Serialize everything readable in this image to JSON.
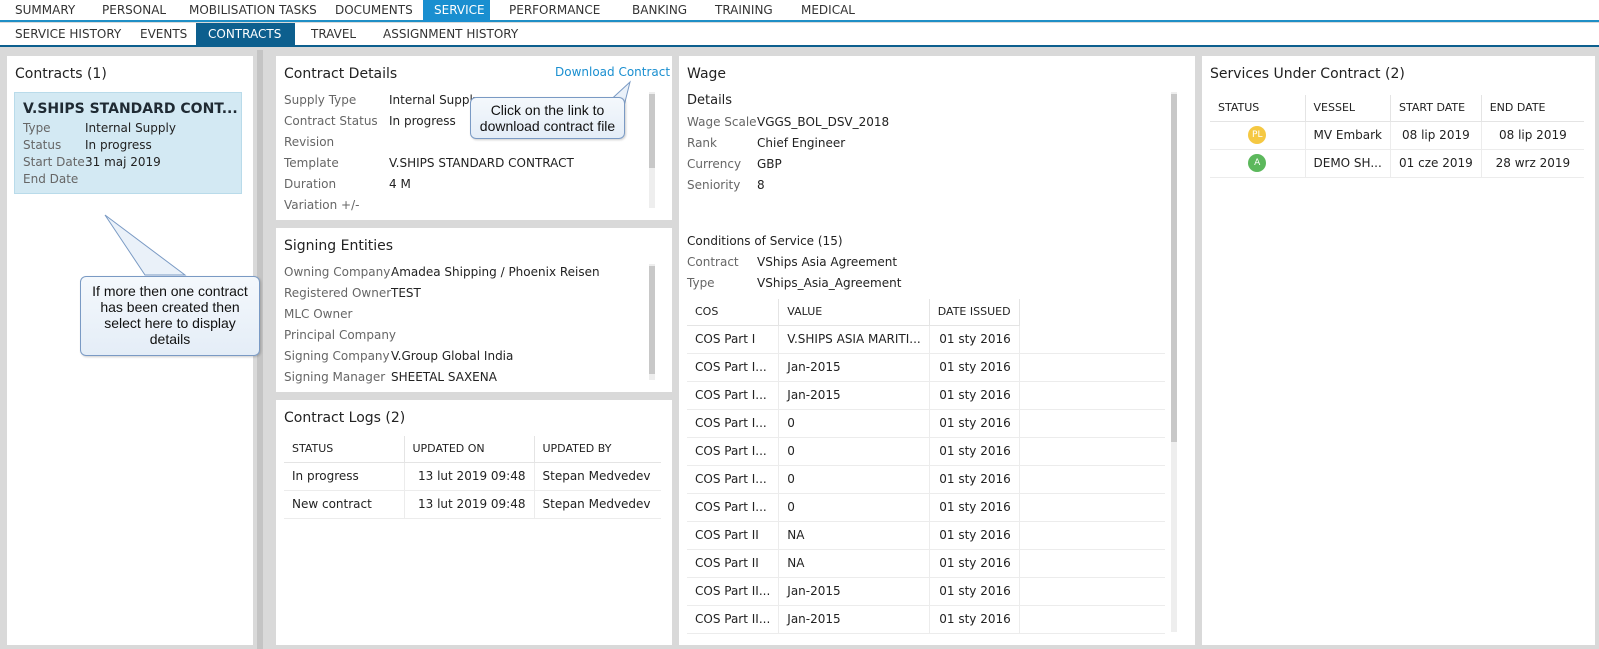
{
  "main_tabs": [
    "SUMMARY",
    "PERSONAL",
    "MOBILISATION TASKS",
    "DOCUMENTS",
    "SERVICE",
    "PERFORMANCE",
    "BANKING",
    "TRAINING",
    "MEDICAL"
  ],
  "sub_tabs": [
    "SERVICE HISTORY",
    "EVENTS",
    "CONTRACTS",
    "TRAVEL",
    "ASSIGNMENT HISTORY"
  ],
  "contracts": {
    "title": "Contracts (1)",
    "card": {
      "name": "V.SHIPS STANDARD CONT...",
      "fields": [
        {
          "label": "Type",
          "value": "Internal Supply"
        },
        {
          "label": "Status",
          "value": "In progress"
        },
        {
          "label": "Start Date",
          "value": "31 maj 2019"
        },
        {
          "label": "End Date",
          "value": ""
        }
      ]
    },
    "callout": "If more then one contract has been created then select here to display details"
  },
  "contract_details": {
    "title": "Contract Details",
    "download_link": "Download Contract",
    "callout": "Click on the link to download contract file",
    "fields": [
      {
        "label": "Supply Type",
        "value": "Internal Supply"
      },
      {
        "label": "Contract Status",
        "value": "In progress"
      },
      {
        "label": "Revision",
        "value": ""
      },
      {
        "label": "Template",
        "value": "V.SHIPS STANDARD CONTRACT"
      },
      {
        "label": "Duration",
        "value": "4 M"
      },
      {
        "label": "Variation +/-",
        "value": ""
      }
    ]
  },
  "signing_entities": {
    "title": "Signing Entities",
    "fields": [
      {
        "label": "Owning Company",
        "value": "Amadea Shipping / Phoenix Reisen"
      },
      {
        "label": "Registered Owner",
        "value": "TEST"
      },
      {
        "label": "MLC Owner",
        "value": ""
      },
      {
        "label": "Principal Company",
        "value": ""
      },
      {
        "label": "Signing Company",
        "value": "V.Group Global India"
      },
      {
        "label": "Signing Manager",
        "value": "SHEETAL SAXENA"
      }
    ]
  },
  "contract_logs": {
    "title": "Contract Logs (2)",
    "columns": [
      "STATUS",
      "UPDATED ON",
      "UPDATED BY"
    ],
    "rows": [
      [
        "In progress",
        "13 lut 2019 09:48",
        "Stepan Medvedev"
      ],
      [
        "New contract",
        "13 lut 2019 09:48",
        "Stepan Medvedev"
      ]
    ]
  },
  "wage": {
    "title": "Wage",
    "details_heading": "Details",
    "fields": [
      {
        "label": "Wage Scale",
        "value": "VGGS_BOL_DSV_2018"
      },
      {
        "label": "Rank",
        "value": "Chief Engineer"
      },
      {
        "label": "Currency",
        "value": "GBP"
      },
      {
        "label": "Seniority",
        "value": "8"
      }
    ],
    "cos_heading": "Conditions of Service (15)",
    "cos_fields": [
      {
        "label": "Contract",
        "value": "VShips Asia Agreement"
      },
      {
        "label": "Type",
        "value": "VShips_Asia_Agreement"
      }
    ],
    "cos_columns": [
      "COS",
      "VALUE",
      "DATE ISSUED"
    ],
    "cos_rows": [
      [
        "COS Part I",
        "V.SHIPS ASIA MARITI...",
        "01 sty 2016"
      ],
      [
        "COS Part I...",
        "Jan-2015",
        "01 sty 2016"
      ],
      [
        "COS Part I...",
        "Jan-2015",
        "01 sty 2016"
      ],
      [
        "COS Part I...",
        "0",
        "01 sty 2016"
      ],
      [
        "COS Part I...",
        "0",
        "01 sty 2016"
      ],
      [
        "COS Part I...",
        "0",
        "01 sty 2016"
      ],
      [
        "COS Part I...",
        "0",
        "01 sty 2016"
      ],
      [
        "COS Part II",
        "NA",
        "01 sty 2016"
      ],
      [
        "COS Part II",
        "NA",
        "01 sty 2016"
      ],
      [
        "COS Part II...",
        "Jan-2015",
        "01 sty 2016"
      ],
      [
        "COS Part II...",
        "Jan-2015",
        "01 sty 2016"
      ]
    ]
  },
  "services": {
    "title": "Services Under Contract (2)",
    "columns": [
      "STATUS",
      "VESSEL",
      "START DATE",
      "END DATE"
    ],
    "rows": [
      {
        "status": "PL",
        "status_color": "#f5c842",
        "vessel": "MV Embark",
        "start": "08 lip 2019",
        "end": "08 lip 2019"
      },
      {
        "status": "A",
        "status_color": "#5cb85c",
        "vessel": "DEMO SH...",
        "start": "01 cze 2019",
        "end": "28 wrz 2019"
      }
    ]
  },
  "colors": {
    "accent": "#1a8fd0",
    "active_subtab": "#0d5f8e",
    "selected_card": "#d3e9f3"
  }
}
